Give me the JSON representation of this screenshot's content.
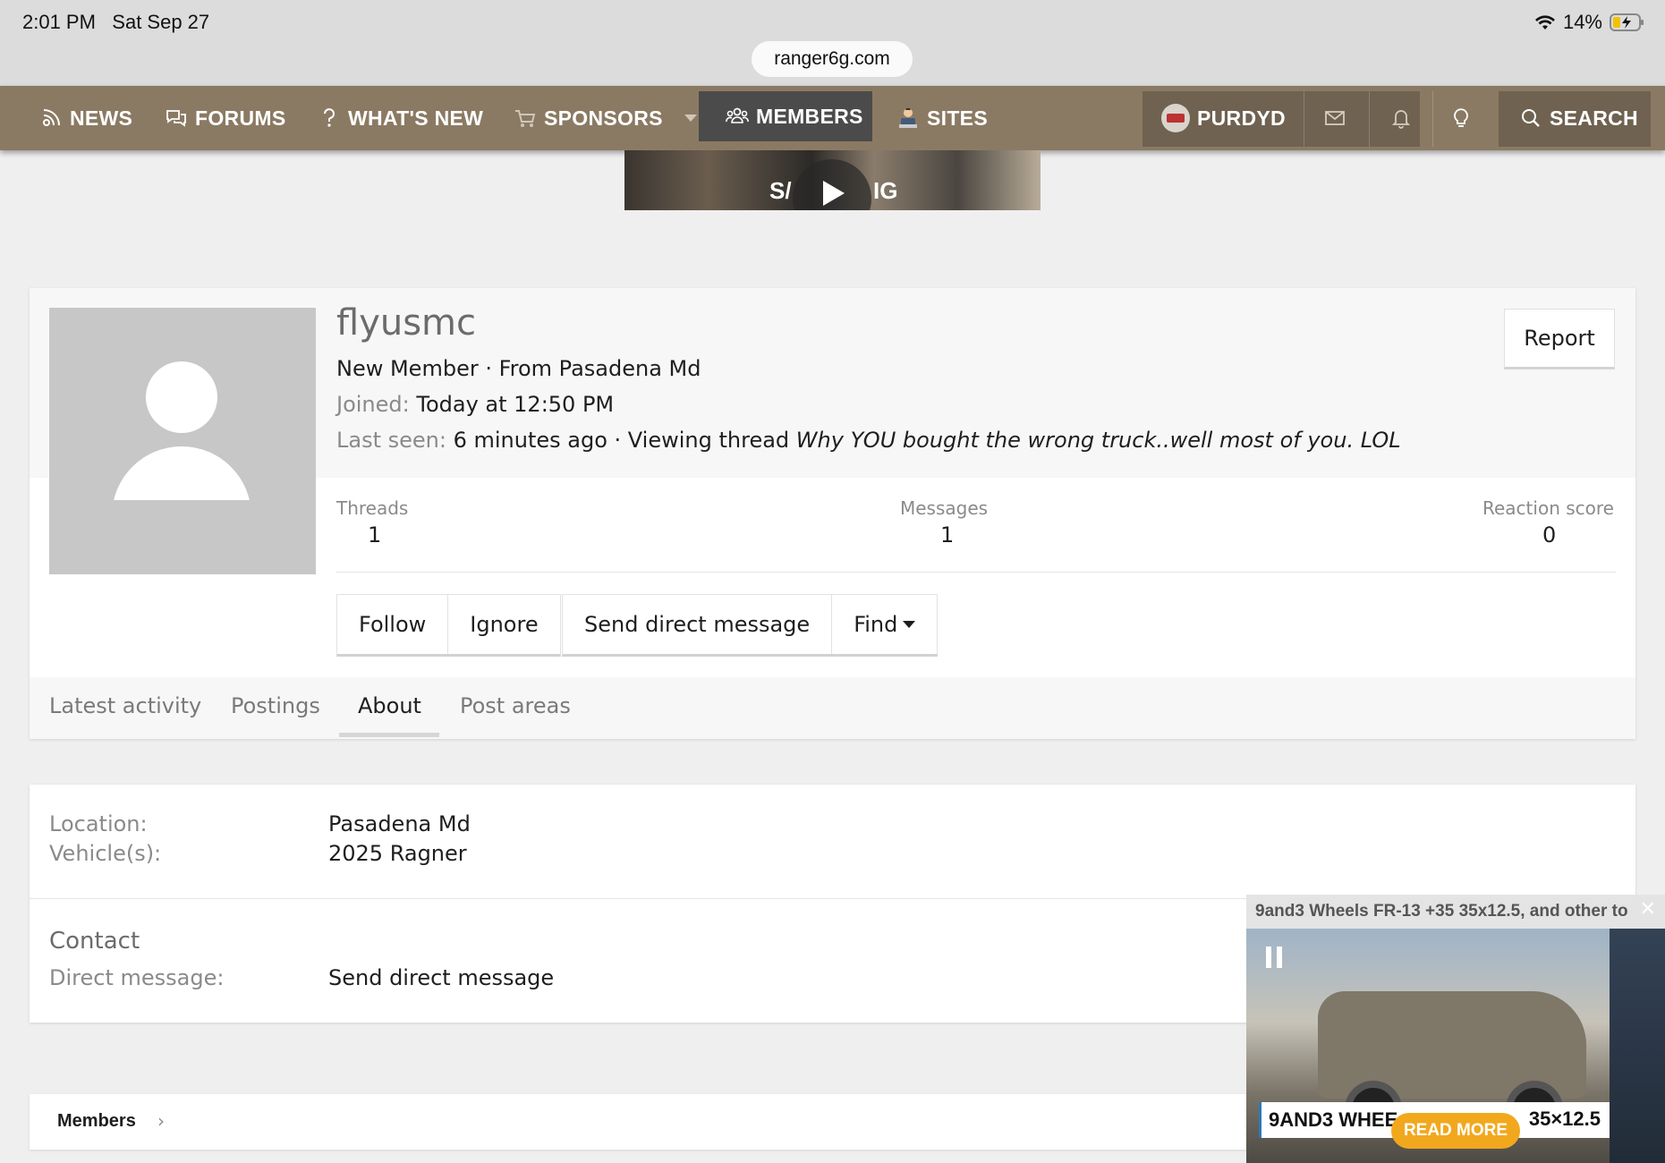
{
  "status_bar": {
    "time": "2:01 PM",
    "date": "Sat Sep 27",
    "battery": "14%",
    "url": "ranger6g.com"
  },
  "nav": {
    "news": "NEWS",
    "forums": "FORUMS",
    "whats_new": "WHAT'S NEW",
    "sponsors": "SPONSORS",
    "members": "MEMBERS",
    "sites": "SITES",
    "user": "PURDYD",
    "search": "SEARCH"
  },
  "banner": {
    "left_text": "S/",
    "right_text": "IG"
  },
  "profile": {
    "username": "flyusmc",
    "title_line": "New Member · From Pasadena Md",
    "joined_label": "Joined:",
    "joined_value": "Today at 12:50 PM",
    "last_seen_label": "Last seen:",
    "last_seen_value": "6 minutes ago · Viewing thread",
    "last_seen_thread": "Why YOU bought the wrong truck..well most of you. LOL",
    "report_label": "Report",
    "stats": {
      "threads_label": "Threads",
      "threads_value": "1",
      "messages_label": "Messages",
      "messages_value": "1",
      "reaction_label": "Reaction score",
      "reaction_value": "0"
    },
    "buttons": {
      "follow": "Follow",
      "ignore": "Ignore",
      "send_dm": "Send direct message",
      "find": "Find"
    }
  },
  "tabs": {
    "latest": "Latest activity",
    "postings": "Postings",
    "about": "About",
    "post_areas": "Post areas"
  },
  "about": {
    "location_label": "Location:",
    "location_value": "Pasadena Md",
    "vehicle_label": "Vehicle(s):",
    "vehicle_value": "2025 Ragner",
    "contact_heading": "Contact",
    "dm_label": "Direct message:",
    "dm_value": "Send direct message"
  },
  "breadcrumb": {
    "members": "Members"
  },
  "ad": {
    "title": "9and3 Wheels FR-13 +35 35x12.5, and other to",
    "caption_left": "9AND3 WHEE",
    "caption_right": "35×12.5",
    "read_more": "READ MORE"
  },
  "colors": {
    "nav_bg": "#8b7a63",
    "nav_active": "#4b4b4b",
    "read_more": "#f2a81d"
  }
}
